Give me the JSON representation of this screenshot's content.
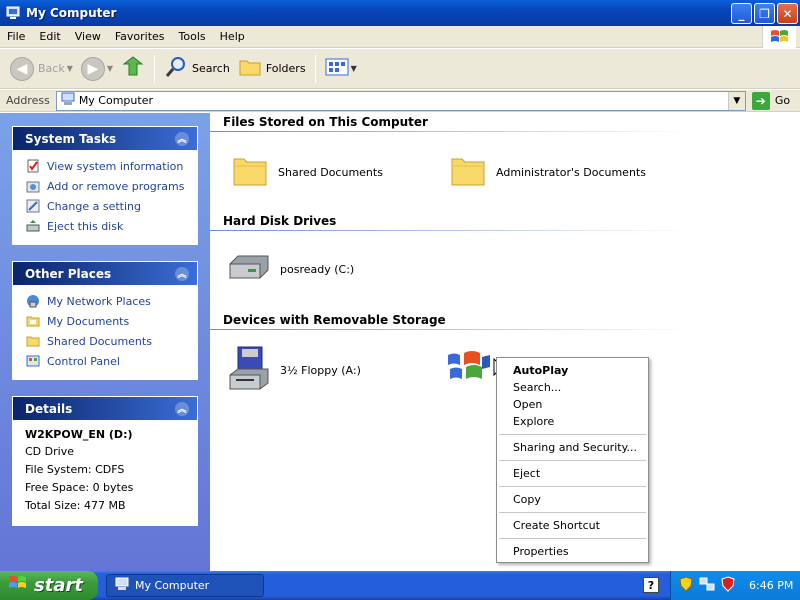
{
  "window": {
    "title": "My Computer"
  },
  "menubar": [
    "File",
    "Edit",
    "View",
    "Favorites",
    "Tools",
    "Help"
  ],
  "toolbar": {
    "back": "Back",
    "search": "Search",
    "folders": "Folders"
  },
  "address": {
    "label": "Address",
    "value": "My Computer",
    "go": "Go"
  },
  "system_tasks": {
    "title": "System Tasks",
    "items": [
      "View system information",
      "Add or remove programs",
      "Change a setting",
      "Eject this disk"
    ]
  },
  "other_places": {
    "title": "Other Places",
    "items": [
      "My Network Places",
      "My Documents",
      "Shared Documents",
      "Control Panel"
    ]
  },
  "details": {
    "title": "Details",
    "name": "W2KPOW_EN (D:)",
    "type": "CD Drive",
    "file_system": "File System: CDFS",
    "free_space": "Free Space: 0 bytes",
    "total_size": "Total Size: 477 MB"
  },
  "groups": {
    "files": {
      "title": "Files Stored on This Computer",
      "items": [
        "Shared Documents",
        "Administrator's Documents"
      ]
    },
    "hdd": {
      "title": "Hard Disk Drives",
      "items": [
        "posready (C:)"
      ]
    },
    "removable": {
      "title": "Devices with Removable Storage",
      "items": [
        "3½ Floppy (A:)"
      ]
    }
  },
  "context_menu": {
    "items": [
      "AutoPlay",
      "Search...",
      "Open",
      "Explore",
      "Sharing and Security...",
      "Eject",
      "Copy",
      "Create Shortcut",
      "Properties"
    ]
  },
  "taskbar": {
    "start": "start",
    "task": "My Computer",
    "clock": "6:46 PM"
  }
}
